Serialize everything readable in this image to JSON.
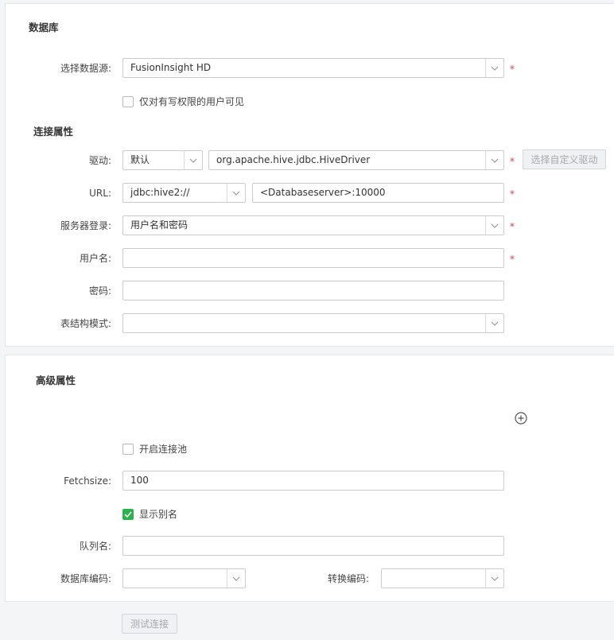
{
  "database_section": {
    "title": "数据库",
    "datasource_label": "选择数据源:",
    "datasource_value": "FusionInsight HD",
    "write_perm_label": "仅对有写权限的用户可见"
  },
  "connection_section": {
    "title": "连接属性",
    "driver_label": "驱动:",
    "driver_mode": "默认",
    "driver_class": "org.apache.hive.jdbc.HiveDriver",
    "custom_driver_button": "选择自定义驱动",
    "url_label": "URL:",
    "url_prefix": "jdbc:hive2://",
    "url_value": "<Databaseserver>:10000",
    "login_label": "服务器登录:",
    "login_value": "用户名和密码",
    "username_label": "用户名:",
    "username_value": "",
    "password_label": "密码:",
    "password_value": "",
    "schema_label": "表结构模式:",
    "schema_value": ""
  },
  "advanced_section": {
    "title": "高级属性",
    "pool_label": "开启连接池",
    "fetchsize_label": "Fetchsize:",
    "fetchsize_value": "100",
    "alias_label": "显示别名",
    "queue_label": "队列名:",
    "queue_value": "",
    "db_encoding_label": "数据库编码:",
    "db_encoding_value": "",
    "convert_encoding_label": "转换编码:",
    "convert_encoding_value": ""
  },
  "test_button": "测试连接",
  "required_mark": "*",
  "colors": {
    "check_green": "#2bb24c",
    "required_red": "#e03c3c"
  },
  "icons": [
    "chevron-down-icon",
    "plus-circle-icon",
    "checkmark-icon"
  ]
}
